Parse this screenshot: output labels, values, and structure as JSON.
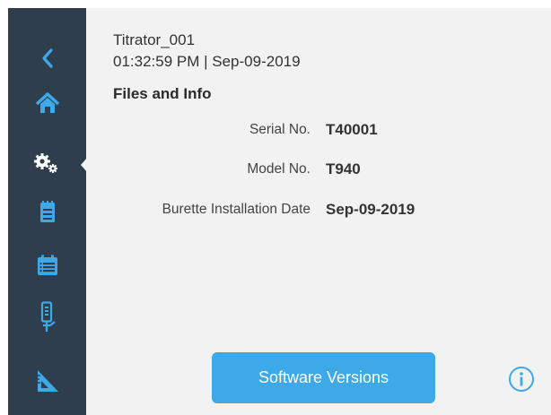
{
  "sidebar": {
    "items": [
      {
        "icon": "back-arrow-icon"
      },
      {
        "icon": "home-icon"
      },
      {
        "icon": "settings-gears-icon",
        "active": true
      },
      {
        "icon": "notepad-icon"
      },
      {
        "icon": "calendar-list-icon"
      },
      {
        "icon": "burette-icon"
      },
      {
        "icon": "triangle-ruler-icon"
      }
    ],
    "background": "#2e3e4c",
    "icon_color": "#ffffff",
    "accent_color": "#3da9e8"
  },
  "header": {
    "device_name": "Titrator_001",
    "datetime": "01:32:59 PM | Sep-09-2019"
  },
  "section_title": "Files and Info",
  "info": {
    "serial_label": "Serial No.",
    "serial_value": "T40001",
    "model_label": "Model No.",
    "model_value": "T940",
    "burette_label": "Burette Installation Date",
    "burette_value": "Sep-09-2019"
  },
  "software_button_label": "Software Versions",
  "info_icon": "info-circle-icon"
}
